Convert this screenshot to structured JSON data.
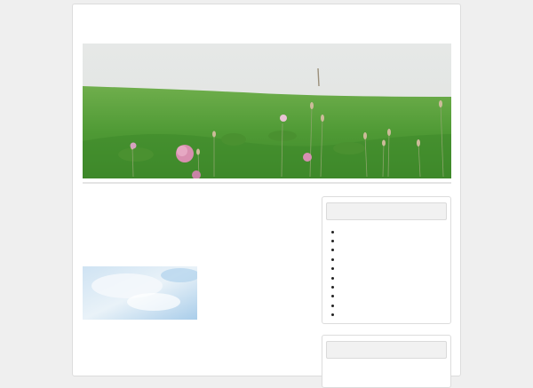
{
  "site": {
    "title": "",
    "accent_color": "#d2683c"
  },
  "post": {
    "title": "",
    "paragraphs": [
      "",
      "",
      "",
      ""
    ]
  },
  "sidebar": {
    "widgets": [
      {
        "title": "",
        "items": [
          {
            "label": ""
          },
          {
            "label": ""
          },
          {
            "label": ""
          },
          {
            "label": ""
          },
          {
            "label": ""
          },
          {
            "label": ""
          },
          {
            "label": ""
          },
          {
            "label": ""
          },
          {
            "label": ""
          },
          {
            "label": ""
          }
        ]
      },
      {
        "title": "",
        "items": []
      }
    ]
  }
}
